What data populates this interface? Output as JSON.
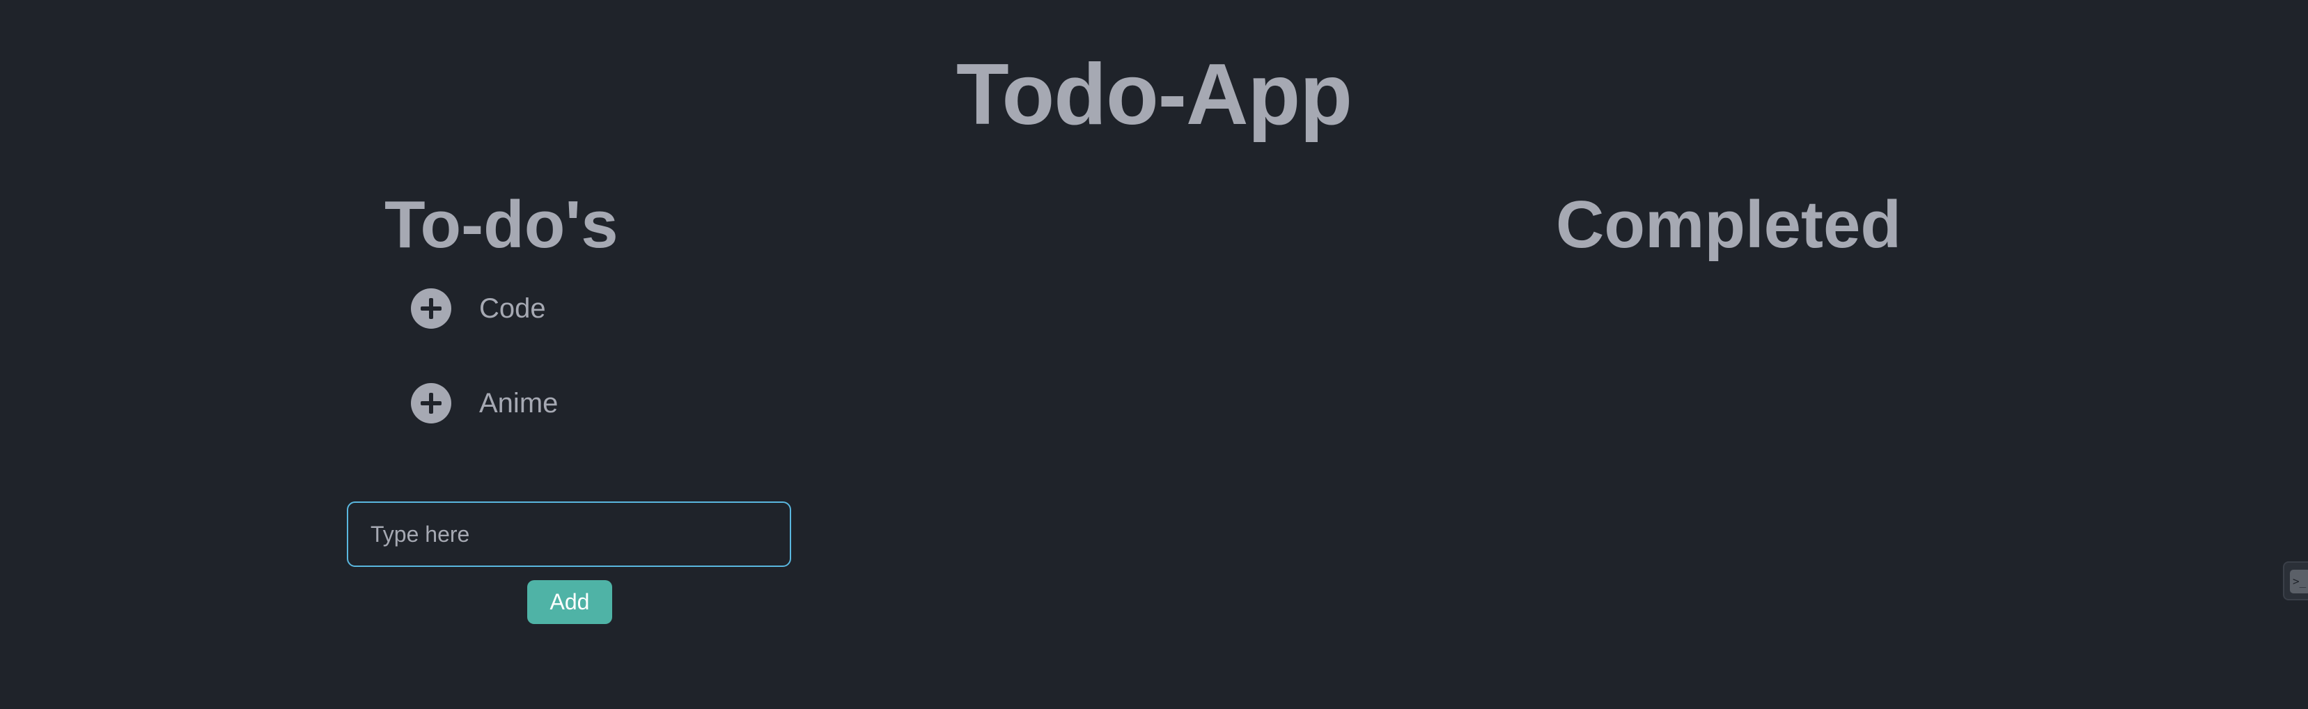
{
  "app": {
    "title": "Todo-App"
  },
  "todos": {
    "title": "To-do's",
    "items": [
      {
        "label": "Code",
        "icon": "plus-circle-icon"
      },
      {
        "label": "Anime",
        "icon": "plus-circle-icon"
      }
    ]
  },
  "completed": {
    "title": "Completed",
    "items": []
  },
  "input": {
    "value": "",
    "placeholder": "Type here"
  },
  "add_button": {
    "label": "Add"
  },
  "terminal_tab": {
    "icon": "terminal-icon",
    "glyph": ">_"
  },
  "colors": {
    "background": "#1f232a",
    "text": "#a6a9b3",
    "accent": "#4fb3a6",
    "input_border": "#5ab7df"
  }
}
